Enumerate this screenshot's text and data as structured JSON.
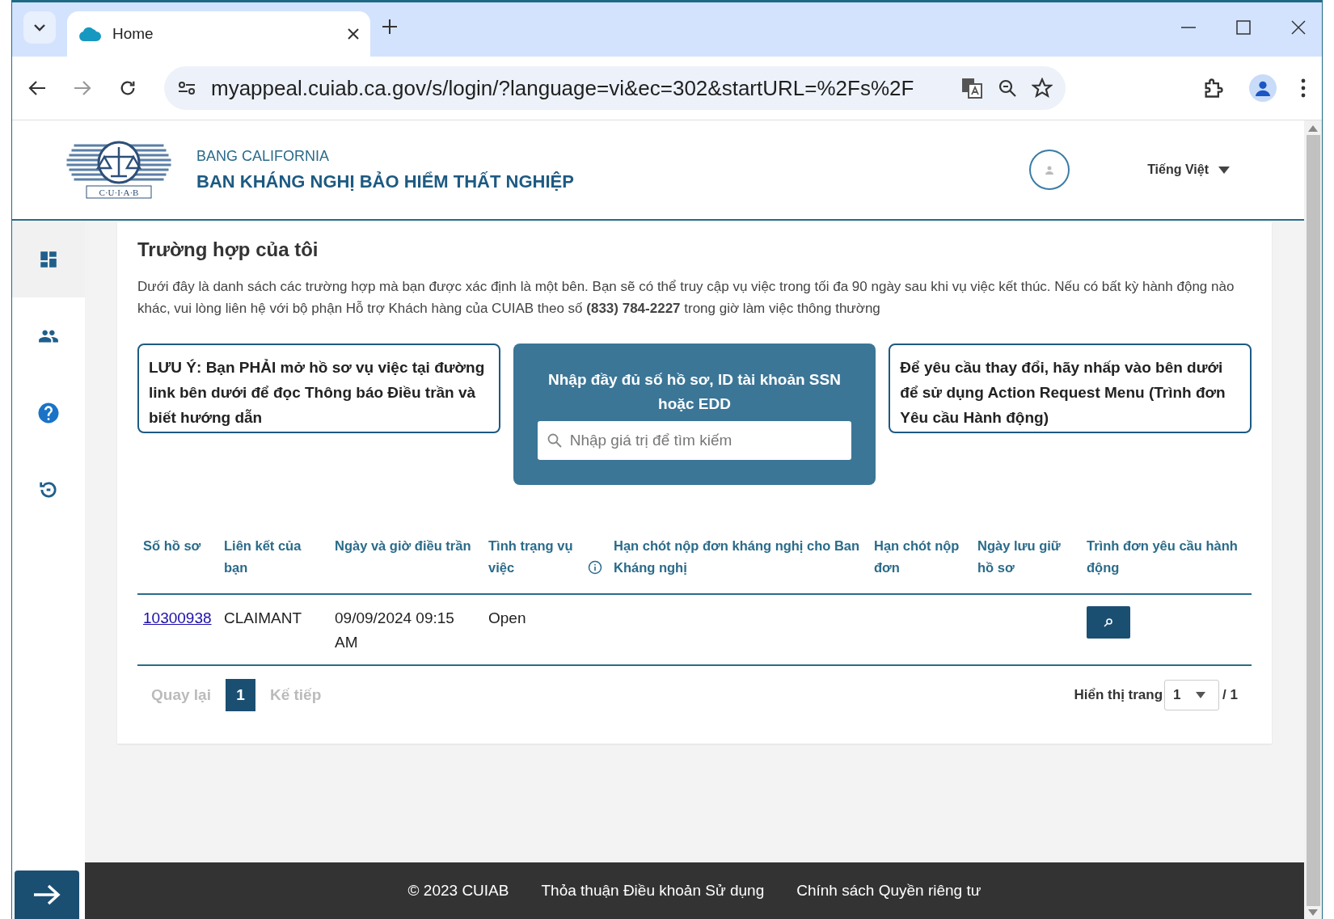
{
  "browser": {
    "tab_title": "Home",
    "url": "myappeal.cuiab.ca.gov/s/login/?language=vi&ec=302&startURL=%2Fs%2F"
  },
  "header": {
    "logo_text": "C·U·I·A·B",
    "state": "BANG CALIFORNIA",
    "agency": "BAN KHÁNG NGHỊ BẢO HIỂM THẤT NGHIỆP",
    "language": "Tiếng Việt"
  },
  "sidebar": {
    "items": [
      {
        "kind": "dashboard",
        "selected": true
      },
      {
        "kind": "people",
        "selected": false
      },
      {
        "kind": "help",
        "selected": false
      },
      {
        "kind": "history",
        "selected": false
      }
    ]
  },
  "page": {
    "title": "Trường hợp của tôi",
    "intro": "Dưới đây là danh sách các trường hợp mà bạn được xác định là một bên. Bạn sẽ có thể truy cập vụ việc trong tối đa 90 ngày sau khi vụ việc kết thúc. Nếu có bất kỳ hành động nào khác, vui lòng liên hệ với bộ phận Hỗ trợ Khách hàng của CUIAB theo số **(833) 784-2227** trong giờ làm việc thông thường",
    "notice_left": "LƯU Ý: Bạn PHẢI mở hồ sơ vụ việc tại đường link bên dưới để đọc Thông báo Điều trần và biết hướng dẫn",
    "search": {
      "title": "Nhập đầy đủ số hồ sơ, ID tài khoản SSN hoặc EDD",
      "placeholder": "Nhập giá trị để tìm kiếm"
    },
    "notice_right": "Để yêu cầu thay đổi, hãy nhấp vào bên dưới để sử dụng Action Request Menu (Trình đơn Yêu cầu Hành động)"
  },
  "table": {
    "columns": [
      {
        "label": "Số hồ sơ",
        "kind": "plain"
      },
      {
        "label": "Liên kết của bạn",
        "kind": "plain"
      },
      {
        "label": "Ngày và giờ điều trần",
        "kind": "plain"
      },
      {
        "label": "Tình trạng vụ việc",
        "kind": "info"
      },
      {
        "label": "Hạn chót nộp đơn kháng nghị cho Ban Kháng nghị",
        "kind": "plain"
      },
      {
        "label": "Hạn chót nộp đơn",
        "kind": "plain"
      },
      {
        "label": "Ngày lưu giữ hồ sơ",
        "kind": "plain"
      },
      {
        "label": "Trình đơn yêu cầu hành động",
        "kind": "plain"
      }
    ],
    "rows": [
      {
        "case_number": "10300938",
        "role": "CLAIMANT",
        "hearing": "09/09/2024 09:15 AM",
        "status": "Open"
      }
    ]
  },
  "pagination": {
    "previous": "Quay lại",
    "pages": [
      {
        "label": "1",
        "selected": true
      }
    ],
    "next": "Kế tiếp",
    "page_label": "Hiển thị trang",
    "page_value": "1",
    "page_total": "/ 1"
  },
  "footer": {
    "links": [
      "© 2023 CUIAB",
      "Thỏa thuận Điều khoản Sử dụng",
      "Chính sách Quyền riêng tư"
    ]
  }
}
